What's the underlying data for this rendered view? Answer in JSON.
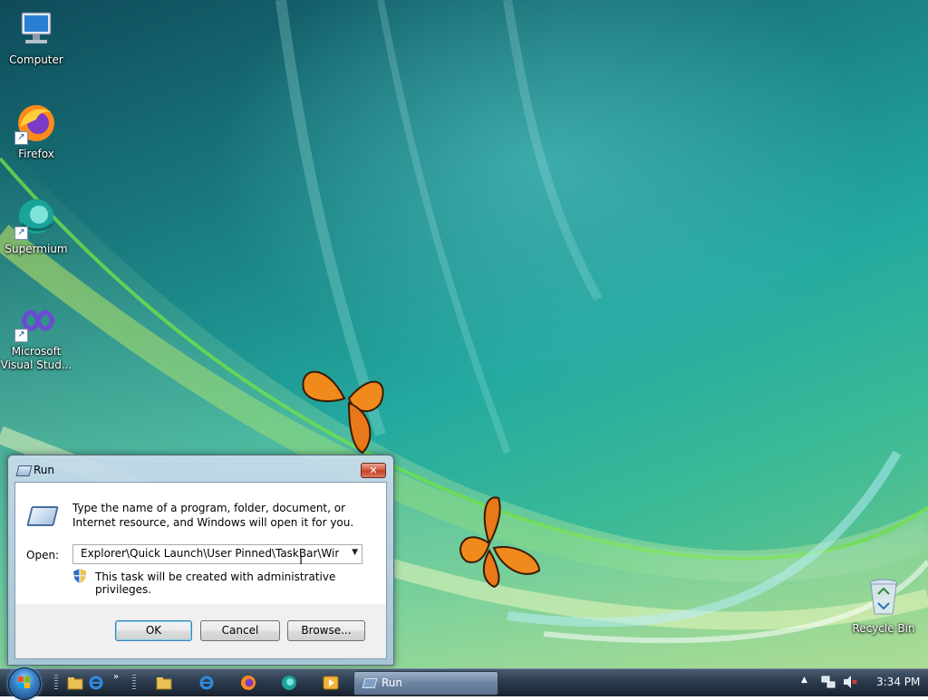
{
  "desktop": {
    "icons": [
      {
        "label": "Computer",
        "icon": "computer-icon"
      },
      {
        "label": "Firefox",
        "icon": "firefox-icon",
        "shortcut": true
      },
      {
        "label": "Supermium",
        "icon": "supermium-icon",
        "shortcut": true
      },
      {
        "label": "Microsoft Visual Stud...",
        "icon": "visual-studio-icon",
        "shortcut": true
      },
      {
        "label": "Recycle Bin",
        "icon": "recycle-bin-icon"
      }
    ]
  },
  "run_dialog": {
    "title": "Run",
    "close_glyph": "✕",
    "description": "Type the name of a program, folder, document, or Internet resource, and Windows will open it for you.",
    "open_label": "Open:",
    "open_value": "Explorer\\Quick Launch\\User Pinned\\TaskBar\\Window\"",
    "admin_note": "This task will be created with administrative privileges.",
    "buttons": {
      "ok": "OK",
      "cancel": "Cancel",
      "browse": "Browse..."
    }
  },
  "taskbar": {
    "quick_launch": [
      "explorer-icon",
      "internet-explorer-icon"
    ],
    "more_glyph": "»",
    "pinned": [
      "explorer-icon",
      "internet-explorer-icon",
      "firefox-icon",
      "supermium-icon",
      "media-player-icon"
    ],
    "running_task": "Run",
    "tray_expand_glyph": "▲",
    "clock": "3:34 PM"
  },
  "colors": {
    "accent": "#3c7fb1",
    "close_red": "#c13d24",
    "taskbar": "#2e3f52"
  }
}
